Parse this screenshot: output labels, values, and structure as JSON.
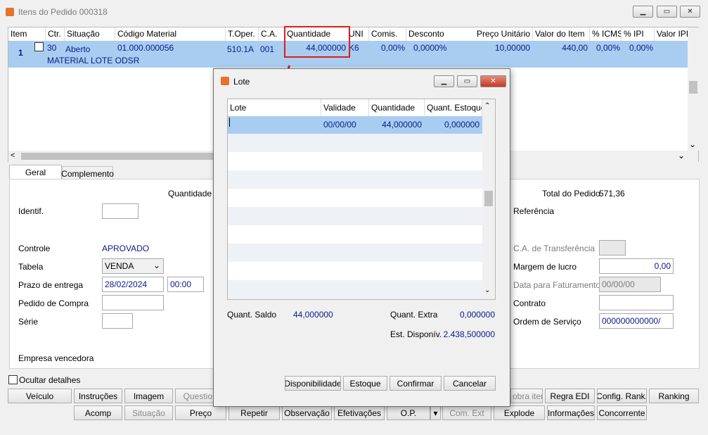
{
  "window": {
    "title": "Itens do Pedido 000318"
  },
  "grid": {
    "headers": [
      "Item",
      "Ctr.",
      "Situação",
      "Código Material",
      "T.Oper.",
      "C.A.",
      "Quantidade",
      "UNI",
      "Comis.",
      "Desconto",
      "Preço Unitário",
      "Valor do Item",
      "% ICMS",
      "% IPI",
      "Valor IPI"
    ],
    "row": {
      "item": "1",
      "ctr": "30",
      "situacao": "Aberto",
      "codigo": "01.000.000056",
      "toper": "510.1A",
      "ca": "001",
      "quantidade": "44,000000",
      "uni": "K6",
      "comis": "0,00%",
      "desconto": "0,0000%",
      "preco": "10,00000",
      "valor": "440,00",
      "icms": "0,00%",
      "ipi": "0,00%",
      "descricao": "MATERIAL LOTE ODSR"
    }
  },
  "tabs": [
    "Geral",
    "Complemento"
  ],
  "form": {
    "quantidade_label": "Quantidade S",
    "identif_label": "Identif.",
    "controle_label": "Controle",
    "controle_value": "APROVADO",
    "tabela_label": "Tabela",
    "tabela_value": "VENDA",
    "prazo_label": "Prazo de entrega",
    "prazo_date": "28/02/2024",
    "prazo_time": "00:00",
    "pedido_compra_label": "Pedido de Compra",
    "serie_label": "Série",
    "empresa_label": "Empresa vencedora",
    "total_label": "Total do Pedido",
    "total_value": "571,36",
    "referencia_label": "Referência",
    "ca_transf_label": "C.A. de Transferência",
    "margem_label": "Margem de lucro",
    "margem_value": "0,00",
    "data_fat_label": "Data para Faturamento",
    "data_fat_value": "00/00/00",
    "contrato_label": "Contrato",
    "ordem_label": "Ordem de Serviço",
    "ordem_value": "000000000000/",
    "ocultar_label": "Ocultar detalhes"
  },
  "buttons_row1": {
    "veiculo": "Veículo",
    "instrucoes": "Instruções",
    "imagem": "Imagem",
    "questionario": "Questio",
    "sobra": "obra itens",
    "regra": "Regra EDI",
    "config": "Config. Rank.",
    "ranking": "Ranking"
  },
  "buttons_row2": {
    "acomp": "Acomp",
    "situacao": "Situação",
    "preco": "Preço",
    "repetir": "Repetir",
    "observacao": "Observação",
    "efetivacoes": "Efetivações",
    "op": "O.P.",
    "comext": "Com. Ext",
    "explode": "Explode",
    "informacoes": "Informações",
    "concorrente": "Concorrente"
  },
  "dialog": {
    "title": "Lote",
    "headers": [
      "Lote",
      "Validade",
      "Quantidade",
      "Quant. Estoque"
    ],
    "row": {
      "lote": "",
      "validade": "00/00/00",
      "quantidade": "44,000000",
      "estoque": "0,000000"
    },
    "saldo_label": "Quant. Saldo",
    "saldo_value": "44,000000",
    "extra_label": "Quant. Extra",
    "extra_value": "0,000000",
    "disp_label": "Est. Disponív.",
    "disp_value": "2.438,500000",
    "buttons": {
      "disponibilidade": "Disponibilidade",
      "estoque": "Estoque",
      "confirmar": "Confirmar",
      "cancelar": "Cancelar"
    }
  },
  "colors": {
    "selection": "#a8cdf0",
    "highlight": "#e01b1b",
    "value_text": "#0a1a8a"
  }
}
